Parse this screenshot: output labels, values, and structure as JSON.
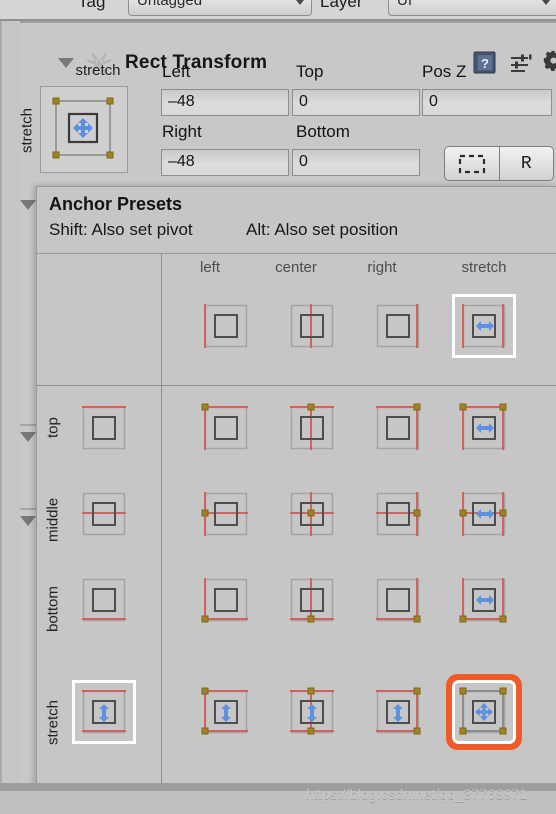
{
  "window": {
    "tag_label": "Tag",
    "tag_value": "Untagged",
    "layer_label": "Layer",
    "layer_value": "UI"
  },
  "component": {
    "title": "Rect Transform",
    "icons": {
      "foldout": "triangle-down-icon",
      "component": "rect-transform-icon",
      "help": "help-book-icon",
      "preset": "preset-sliders-icon",
      "settings": "gear-icon"
    },
    "anchor_button": {
      "top_label": "stretch",
      "side_label": "stretch",
      "glyph": "move-4way-icon"
    },
    "fields": [
      {
        "label": "Left",
        "value": "–48"
      },
      {
        "label": "Top",
        "value": "0"
      },
      {
        "label": "Pos Z",
        "value": "0"
      },
      {
        "label": "Right",
        "value": "–48"
      },
      {
        "label": "Bottom",
        "value": "0"
      }
    ],
    "mode_buttons": {
      "blueprint": "blueprint-mode-icon",
      "raw_label": "R"
    }
  },
  "anchor_presets": {
    "title": "Anchor Presets",
    "hint_shift": "Shift: Also set pivot",
    "hint_alt": "Alt: Also set position",
    "columns": [
      "left",
      "center",
      "right",
      "stretch"
    ],
    "rows": [
      "top",
      "middle",
      "bottom",
      "stretch"
    ],
    "selected": {
      "row": "stretch",
      "column": "stretch"
    },
    "hovered_headers": {
      "column": "stretch",
      "row": "stretch"
    },
    "colors": {
      "anchor_line": "#d4625c",
      "anchor_dot": "#a08424",
      "arrow": "#5b91e0",
      "selection": "#f05a28",
      "highlight": "#ffffff",
      "panel_bg": "#c6c6c6"
    }
  },
  "watermark": "https://blog.csdn.net/qq_37768971"
}
